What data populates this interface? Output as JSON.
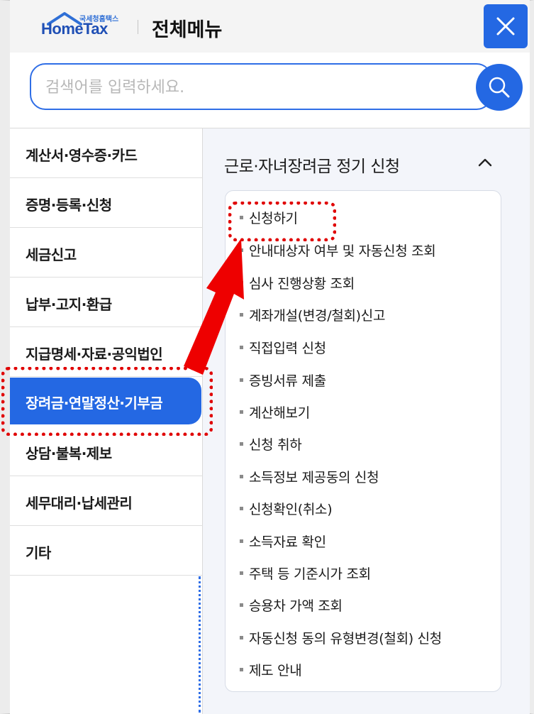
{
  "header": {
    "logo_small": "국세청홈택스",
    "logo_big": "HomeTax",
    "title": "전체메뉴",
    "close_icon": "close-icon"
  },
  "search": {
    "placeholder": "검색어를 입력하세요.",
    "value": "",
    "icon": "search-icon"
  },
  "leftmenu": {
    "items": [
      {
        "label": "계산서·영수증·카드"
      },
      {
        "label": "증명·등록·신청"
      },
      {
        "label": "세금신고"
      },
      {
        "label": "납부·고지·환급"
      },
      {
        "label": "지급명세·자료·공익법인"
      },
      {
        "label": "장려금·연말정산·기부금"
      },
      {
        "label": "상담·불복·제보"
      },
      {
        "label": "세무대리·납세관리"
      },
      {
        "label": "기타"
      }
    ],
    "active_index": 5
  },
  "section": {
    "title": "근로·자녀장려금 정기 신청",
    "toggle_icon": "chevron-up-icon",
    "items": [
      {
        "label": "신청하기"
      },
      {
        "label": "안내대상자 여부 및 자동신청 조회"
      },
      {
        "label": "심사 진행상황 조회"
      },
      {
        "label": "계좌개설(변경/철회)신고"
      },
      {
        "label": "직접입력 신청"
      },
      {
        "label": "증빙서류 제출"
      },
      {
        "label": "계산해보기"
      },
      {
        "label": "신청 취하"
      },
      {
        "label": "소득정보 제공동의 신청"
      },
      {
        "label": "신청확인(취소)"
      },
      {
        "label": "소득자료 확인"
      },
      {
        "label": "주택 등 기준시가 조회"
      },
      {
        "label": "승용차 가액 조회"
      },
      {
        "label": "자동신청 동의 유형변경(철회) 신청"
      },
      {
        "label": "제도 안내"
      }
    ]
  },
  "colors": {
    "accent": "#2468e3",
    "annotation": "#e00000"
  }
}
